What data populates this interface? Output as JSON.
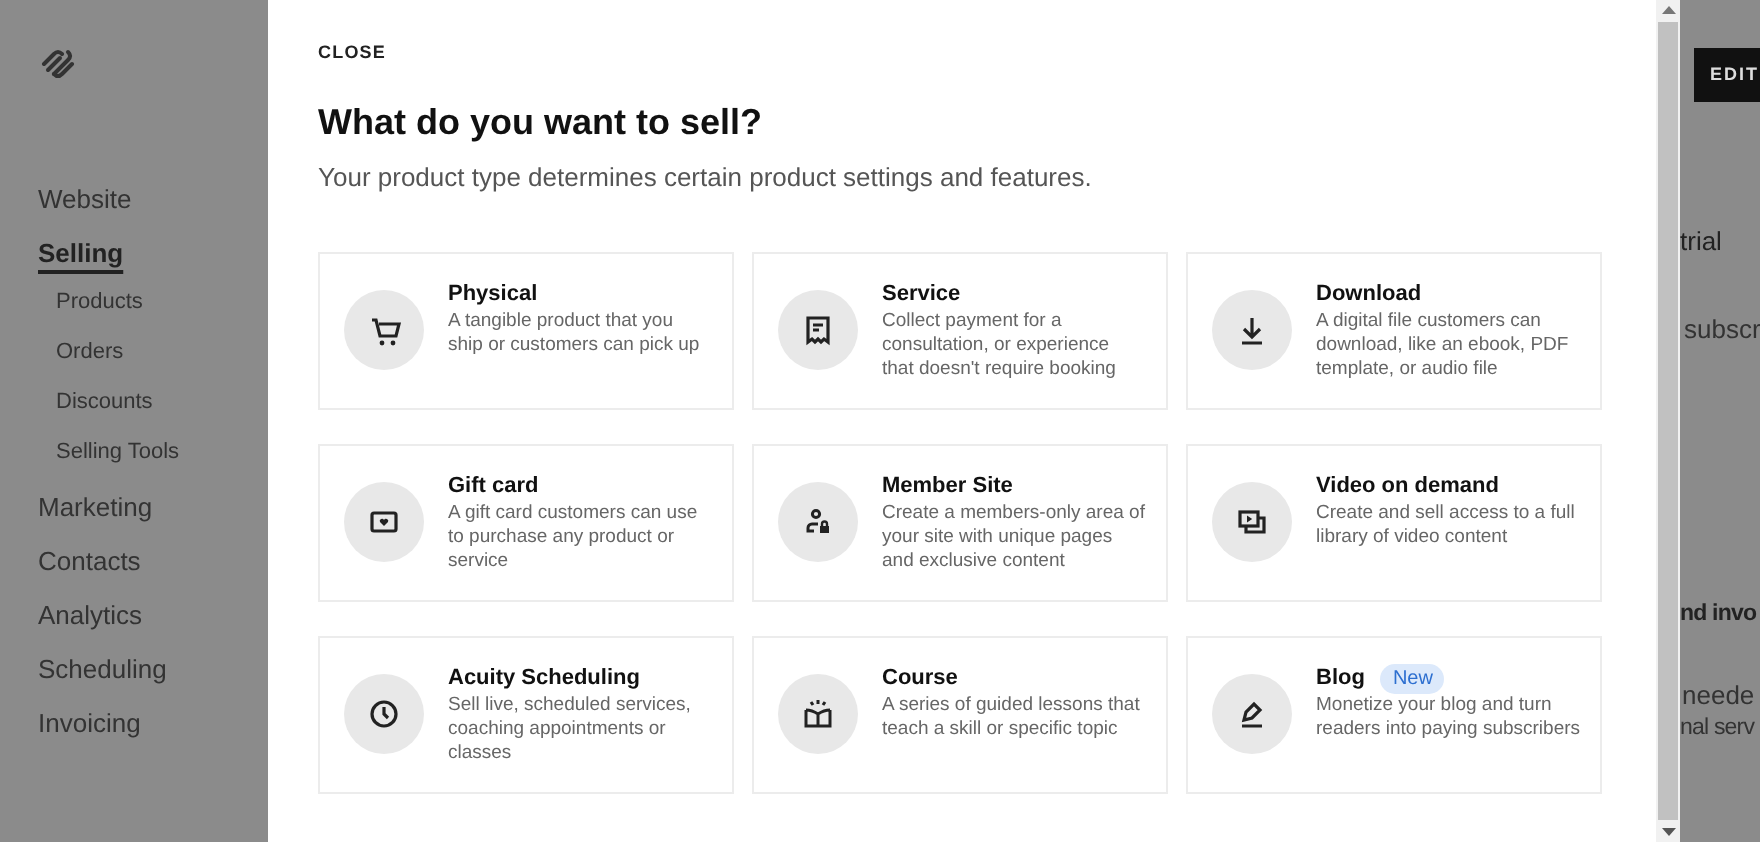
{
  "sidebar": {
    "items": [
      {
        "label": "Website",
        "selected": false
      },
      {
        "label": "Selling",
        "selected": true,
        "children": [
          {
            "label": "Products"
          },
          {
            "label": "Orders"
          },
          {
            "label": "Discounts"
          },
          {
            "label": "Selling Tools"
          }
        ]
      },
      {
        "label": "Marketing",
        "selected": false
      },
      {
        "label": "Contacts",
        "selected": false
      },
      {
        "label": "Analytics",
        "selected": false
      },
      {
        "label": "Scheduling",
        "selected": false
      },
      {
        "label": "Invoicing",
        "selected": false
      }
    ]
  },
  "modal": {
    "close": "CLOSE",
    "title": "What do you want to sell?",
    "subtitle": "Your product type determines certain product settings and features.",
    "options": [
      {
        "kind": "cart",
        "title": "Physical",
        "description": "A tangible product that you ship or customers can pick up"
      },
      {
        "kind": "receipt",
        "title": "Service",
        "description": "Collect payment for a consultation, or experience that doesn't require booking"
      },
      {
        "kind": "download",
        "title": "Download",
        "description": "A digital file customers can download, like an ebook, PDF template, or audio file"
      },
      {
        "kind": "giftcard",
        "title": "Gift card",
        "description": "A gift card customers can use to purchase any product or service"
      },
      {
        "kind": "member",
        "title": "Member Site",
        "description": "Create a members-only area of your site with unique pages and exclusive content"
      },
      {
        "kind": "video",
        "title": "Video on demand",
        "description": "Create and sell access to a full library of video content"
      },
      {
        "kind": "clock",
        "title": "Acuity Scheduling",
        "description": "Sell live, scheduled services, coaching appointments or classes"
      },
      {
        "kind": "book",
        "title": "Course",
        "description": "A series of guided lessons that teach a skill or specific topic"
      },
      {
        "kind": "pen",
        "title": "Blog",
        "badge": "New",
        "description": "Monetize your blog and turn readers into paying subscribers"
      }
    ]
  },
  "background": {
    "edit_button": "EDIT",
    "texts": [
      "trial",
      "subscr",
      "nd invo",
      "neede",
      "nal serv"
    ]
  }
}
